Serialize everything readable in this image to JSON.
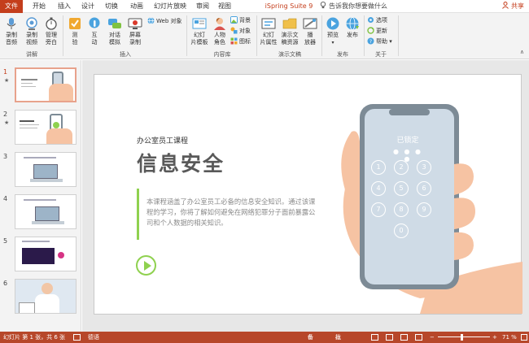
{
  "tabs": {
    "file": "文件",
    "home": "开始",
    "insert": "插入",
    "design": "设计",
    "transitions": "切换",
    "animations": "动画",
    "slideshow": "幻灯片放映",
    "review": "审阅",
    "view": "视图",
    "ispring": "iSpring Suite 9",
    "tell_me": "告诉我你想要做什么",
    "share": "共享"
  },
  "ribbon": {
    "record_audio": [
      "录制",
      "音频"
    ],
    "record_video": [
      "录制",
      "视频"
    ],
    "manage_narration": [
      "管理",
      "旁白"
    ],
    "group_narration": "讲解",
    "quiz": [
      "测",
      "验"
    ],
    "interaction": [
      "互",
      "动"
    ],
    "dialog_sim": [
      "对话",
      "模拟"
    ],
    "screen_record": [
      "屏幕",
      "录制"
    ],
    "web_object": "Web 对象",
    "group_insert": "插入",
    "slide_template": [
      "幻灯",
      "片模板"
    ],
    "characters": [
      "人物",
      "角色"
    ],
    "background": "背景",
    "objects": "对象",
    "icons": "图标",
    "group_library": "内容库",
    "slide_props": [
      "幻灯",
      "片属性"
    ],
    "presentation_resources": [
      "演示文",
      "稿资源"
    ],
    "player": [
      "播",
      "放器"
    ],
    "group_presentation": "演示文稿",
    "preview": "预览",
    "publish": "发布",
    "group_publish": "发布",
    "options": "选项",
    "update": "更新",
    "help": "帮助",
    "group_about": "关于"
  },
  "thumbnails": [
    {
      "num": "1",
      "star": "★",
      "selected": true
    },
    {
      "num": "2",
      "star": "★",
      "selected": false
    },
    {
      "num": "3",
      "star": "",
      "selected": false
    },
    {
      "num": "4",
      "star": "",
      "selected": false
    },
    {
      "num": "5",
      "star": "",
      "selected": false
    },
    {
      "num": "6",
      "star": "",
      "selected": false
    }
  ],
  "slide": {
    "course": "办公室员工课程",
    "title": "信息安全",
    "description": "本课程涵盖了办公室员工必备的信息安全知识。通过该课程的学习，你将了解如何避免在网络犯罪分子面前暴露公司和个人数据的相关知识。",
    "phone_locked": "已锁定",
    "keypad": [
      "1",
      "2",
      "3",
      "4",
      "5",
      "6",
      "7",
      "8",
      "9",
      "0"
    ]
  },
  "status": {
    "slide_info": "幻灯片 第 1 张，共 6 张",
    "language": "德语",
    "notes": "备注",
    "comments": "批注",
    "zoom": "71 %"
  },
  "colors": {
    "accent": "#c43e1c",
    "status_bar": "#b7472a",
    "green": "#8fd14f"
  }
}
